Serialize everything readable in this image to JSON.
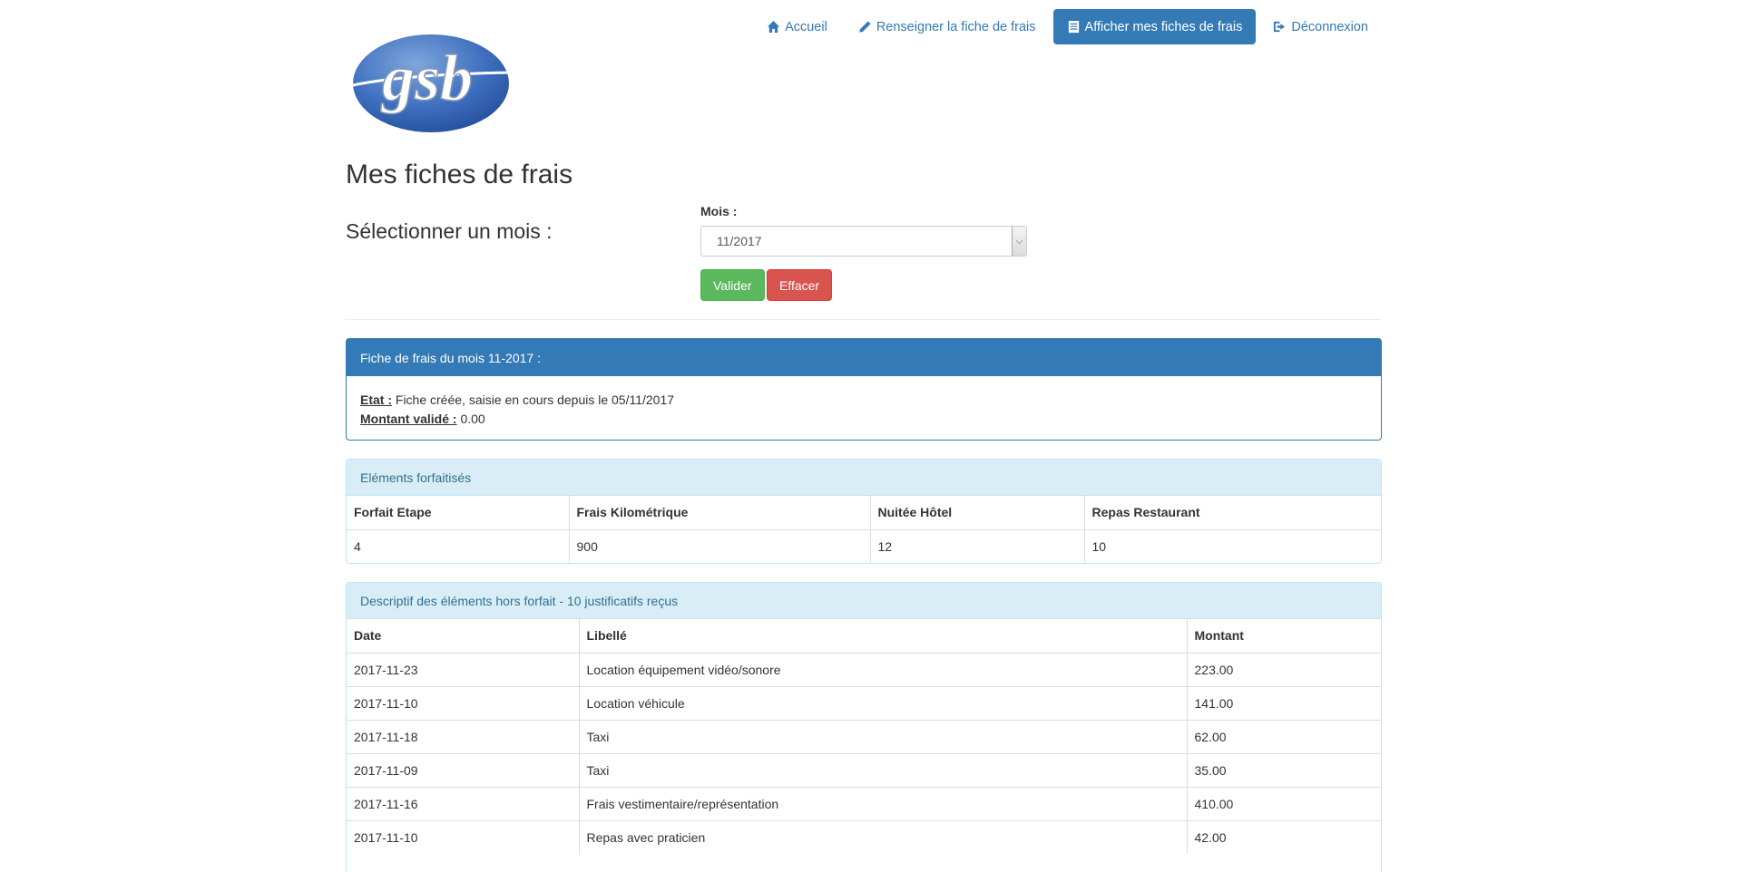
{
  "nav": {
    "items": [
      {
        "label": "Accueil",
        "icon": "home-icon"
      },
      {
        "label": "Renseigner la fiche de frais",
        "icon": "pencil-icon"
      },
      {
        "label": "Afficher mes fiches de frais",
        "icon": "list-icon",
        "active": true
      },
      {
        "label": "Déconnexion",
        "icon": "logout-icon"
      }
    ]
  },
  "logo": {
    "text": "gsb"
  },
  "page": {
    "title": "Mes fiches de frais",
    "select_month_label": "Sélectionner un mois :"
  },
  "form": {
    "mois_label": "Mois :",
    "selected_month": "11/2017",
    "valider_label": "Valider",
    "effacer_label": "Effacer"
  },
  "fiche": {
    "header": "Fiche de frais du mois 11-2017 :",
    "etat_label": "Etat :",
    "etat_value": "Fiche créée, saisie en cours depuis le 05/11/2017",
    "montant_label": "Montant validé :",
    "montant_value": "0.00"
  },
  "forfait": {
    "header": "Eléments forfaitisés",
    "columns": [
      "Forfait Etape",
      "Frais Kilométrique",
      "Nuitée Hôtel",
      "Repas Restaurant"
    ],
    "values": [
      "4",
      "900",
      "12",
      "10"
    ]
  },
  "hors_forfait": {
    "header": "Descriptif des éléments hors forfait - 10 justificatifs reçus",
    "columns": [
      "Date",
      "Libellé",
      "Montant"
    ],
    "rows": [
      [
        "2017-11-23",
        "Location équipement vidéo/sonore",
        "223.00"
      ],
      [
        "2017-11-10",
        "Location véhicule",
        "141.00"
      ],
      [
        "2017-11-18",
        "Taxi",
        "62.00"
      ],
      [
        "2017-11-09",
        "Taxi",
        "35.00"
      ],
      [
        "2017-11-16",
        "Frais vestimentaire/représentation",
        "410.00"
      ],
      [
        "2017-11-10",
        "Repas avec praticien",
        "42.00"
      ]
    ]
  },
  "colors": {
    "primary": "#337ab7",
    "success": "#5cb85c",
    "danger": "#d9534f",
    "info_bg": "#d9edf7",
    "info_text": "#31708f"
  }
}
